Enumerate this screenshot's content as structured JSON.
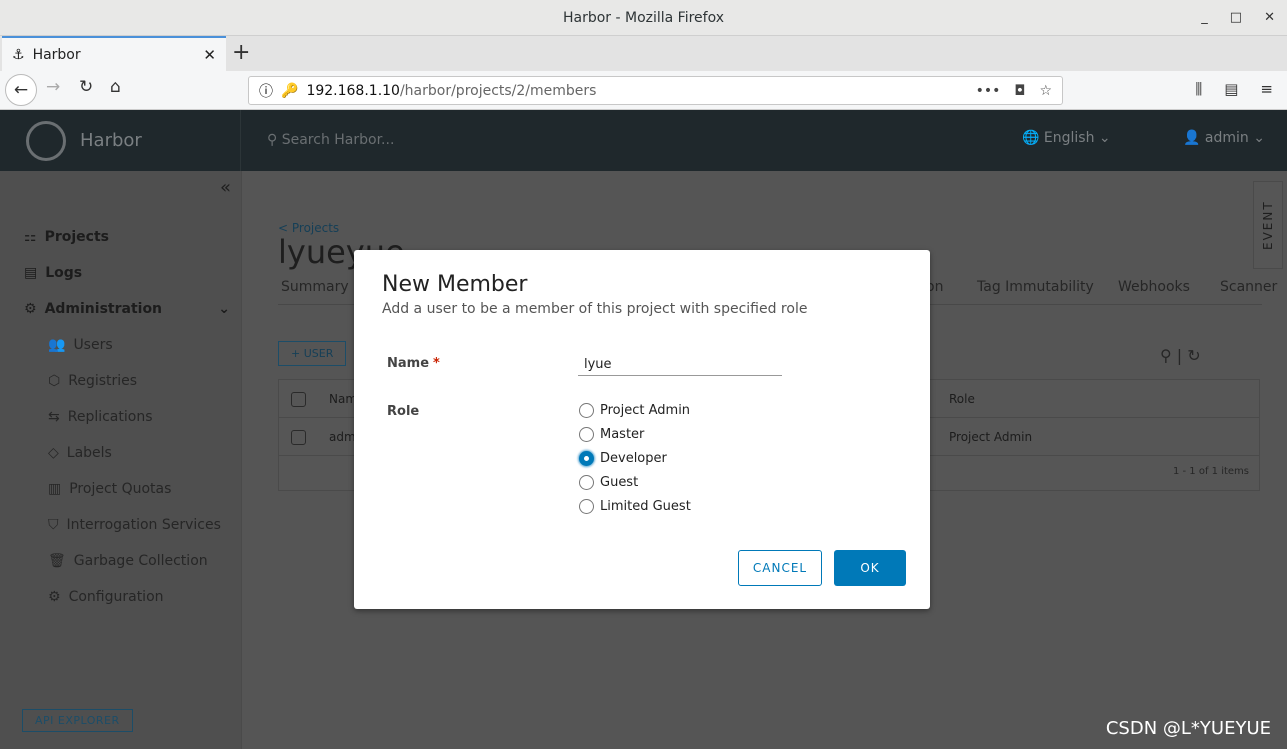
{
  "window": {
    "title": "Harbor - Mozilla Firefox",
    "min": "_",
    "max": "□",
    "close": "✕"
  },
  "browser": {
    "tab_title": "Harbor",
    "tab_close": "✕",
    "new_tab": "+",
    "url_host": "192.168.1.10",
    "url_path": "/harbor/projects/2/members"
  },
  "header": {
    "brand": "Harbor",
    "search_placeholder": "Search Harbor...",
    "language": "English ⌄",
    "user": "admin ⌄"
  },
  "sidebar": {
    "collapse": "«",
    "items": [
      {
        "label": "Projects",
        "icon": "projects-icon"
      },
      {
        "label": "Logs",
        "icon": "logs-icon"
      },
      {
        "label": "Administration",
        "icon": "admin-icon"
      },
      {
        "label": "Users"
      },
      {
        "label": "Registries"
      },
      {
        "label": "Replications"
      },
      {
        "label": "Labels"
      },
      {
        "label": "Project Quotas"
      },
      {
        "label": "Interrogation Services"
      },
      {
        "label": "Garbage Collection"
      },
      {
        "label": "Configuration"
      }
    ],
    "api_explorer": "API EXPLORER"
  },
  "main": {
    "breadcrumb": "< Projects",
    "title": "lyueyue",
    "tabs": [
      "Summary",
      "on",
      "Tag Immutability",
      "Webhooks",
      "Scanner"
    ],
    "add_user": "+ USER",
    "columns": [
      "Nam",
      "Role"
    ],
    "rows": [
      {
        "name": "adm",
        "role": "Project Admin"
      }
    ],
    "pagination": "1 - 1 of 1 items",
    "event_tab": "EVENT"
  },
  "modal": {
    "title": "New Member",
    "subtitle": "Add a user to be a member of this project with specified role",
    "name_label": "Name",
    "required": "*",
    "name_value": "lyue",
    "role_label": "Role",
    "roles": [
      "Project Admin",
      "Master",
      "Developer",
      "Guest",
      "Limited Guest"
    ],
    "selected_role": "Developer",
    "cancel": "CANCEL",
    "ok": "OK"
  },
  "watermark": "CSDN @L*YUEYUE",
  "colors": {
    "accent": "#0079b8",
    "header": "#2b3a42"
  }
}
